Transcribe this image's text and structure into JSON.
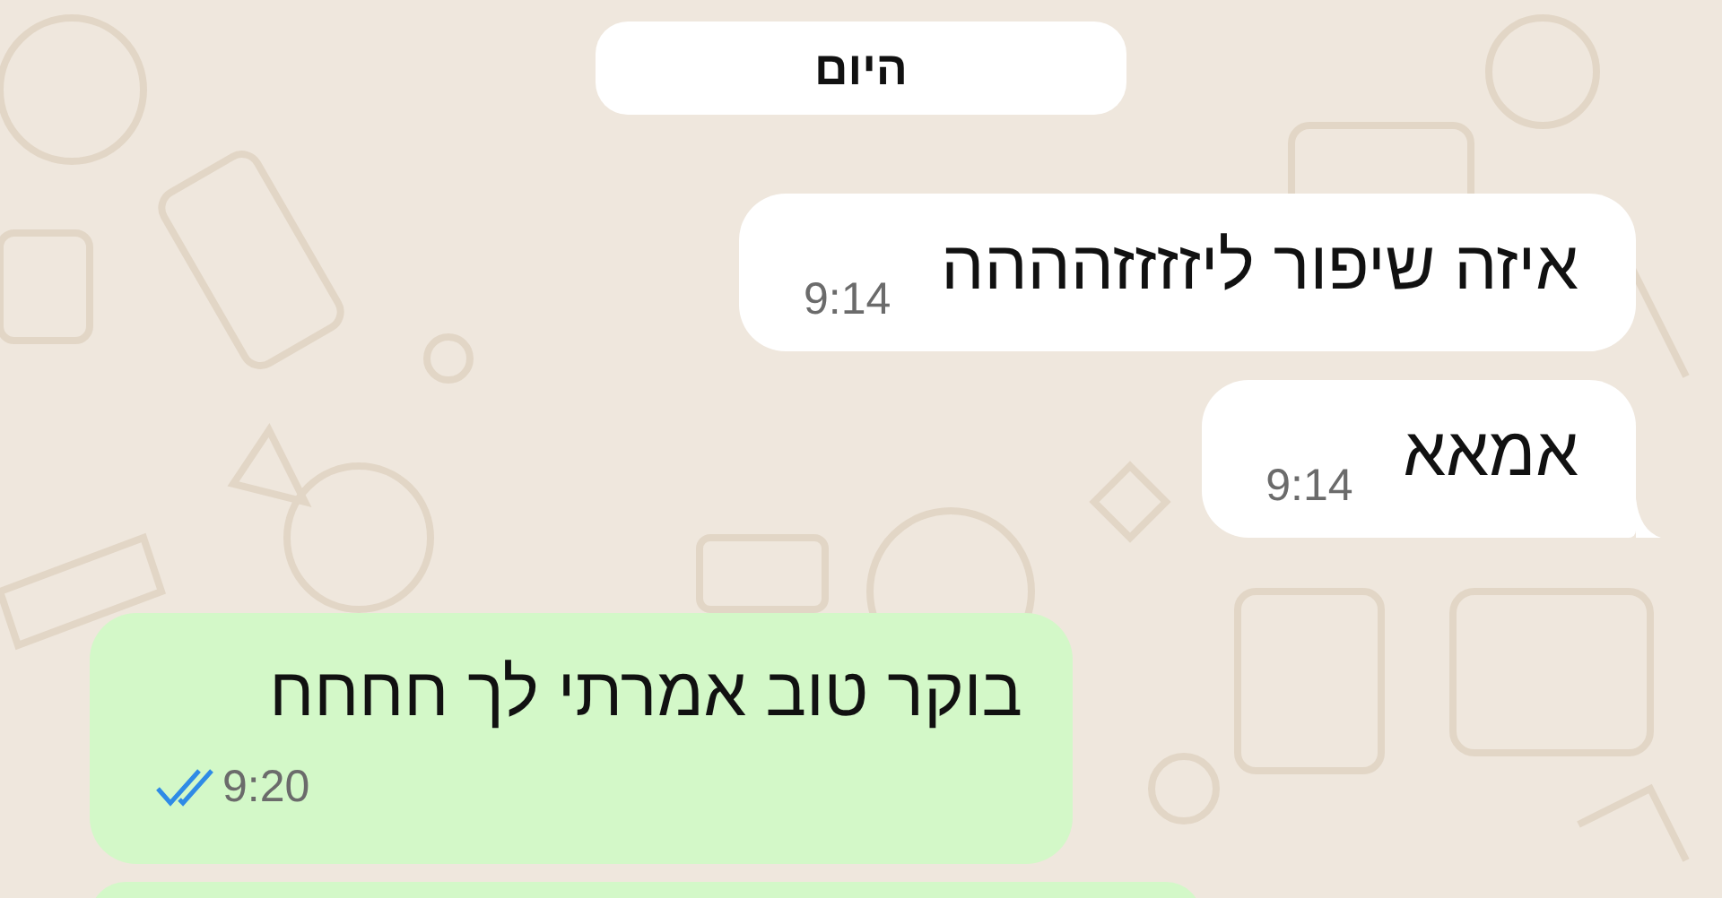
{
  "date_chip": "היום",
  "messages": [
    {
      "kind": "incoming",
      "text": "איזה שיפור ליזזזזהההה",
      "time": "9:14",
      "tail": false
    },
    {
      "kind": "incoming",
      "text": "אמאא",
      "time": "9:14",
      "tail": true
    },
    {
      "kind": "outgoing",
      "text": "בוקר טוב אמרתי לך חחחח",
      "time": "9:20",
      "read": true,
      "tail": false
    }
  ]
}
